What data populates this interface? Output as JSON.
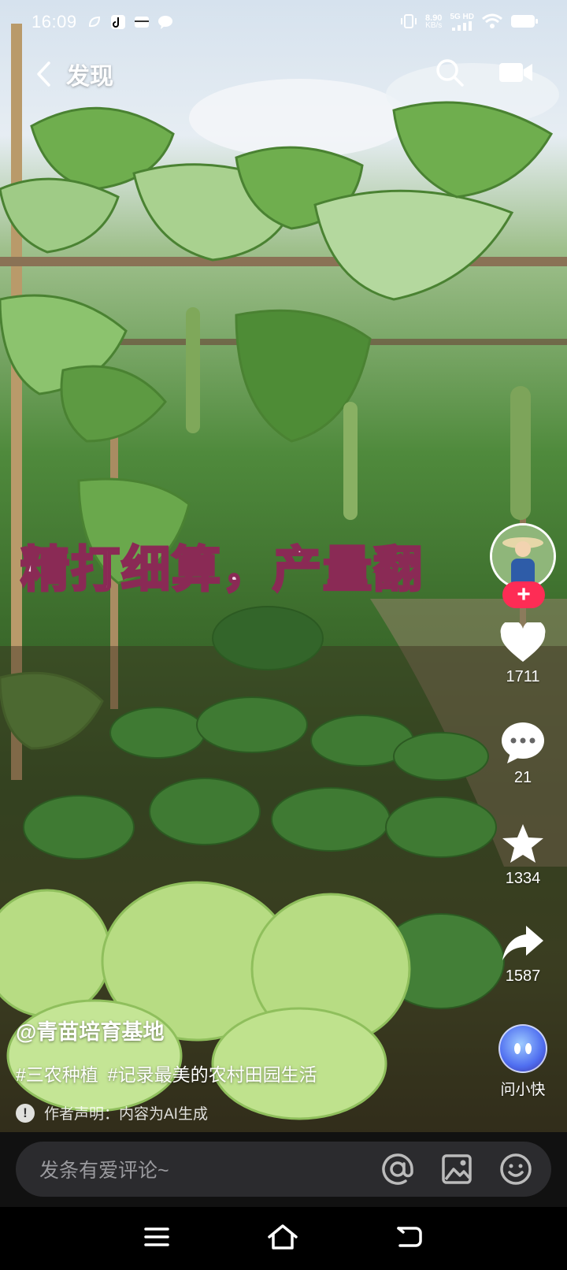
{
  "status_bar": {
    "time": "16:09",
    "net_speed_value": "8.90",
    "net_speed_unit": "KB/s",
    "network": "5G HD"
  },
  "top_nav": {
    "title": "发现"
  },
  "video": {
    "caption": "精打细算，产量翻"
  },
  "actions": {
    "follow_label": "+",
    "like_count": "1711",
    "comment_count": "21",
    "favorite_count": "1334",
    "share_count": "1587",
    "ask_label": "问小快"
  },
  "post": {
    "author_handle": "@青苗培育基地",
    "hashtags": [
      "#三农种植",
      "#记录最美的农村田园生活"
    ],
    "declaration": "作者声明：内容为AI生成",
    "declaration_icon": "!"
  },
  "comment_bar": {
    "placeholder": "发条有爱评论~"
  },
  "colors": {
    "accent_red": "#fe2c55",
    "caption_fill": "#f4d7e8",
    "caption_stroke": "#8a2a55",
    "comment_bar_bg": "#2b2b2e"
  }
}
